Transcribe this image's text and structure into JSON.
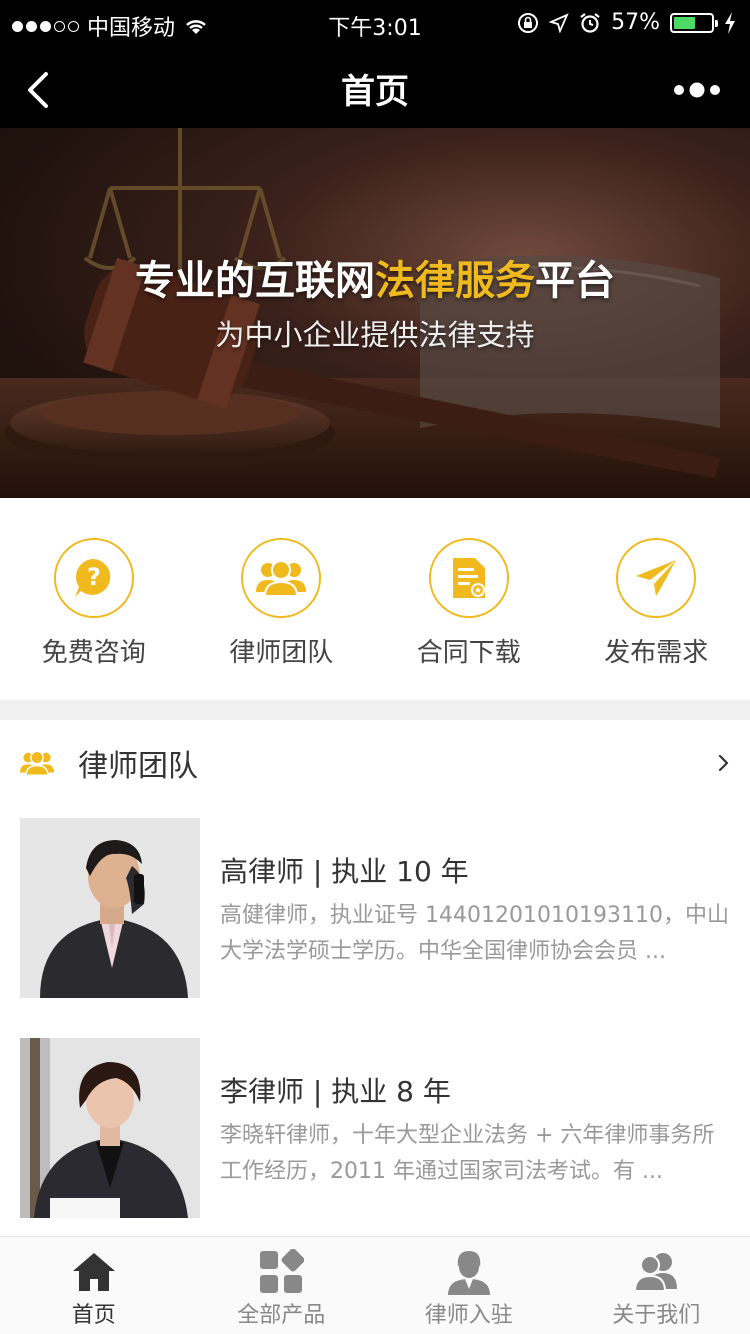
{
  "status_bar": {
    "carrier": "中国移动",
    "time": "下午3:01",
    "battery": "57%",
    "battery_level": 0.57,
    "icons": [
      "signal-dots-icon",
      "wifi-icon",
      "rotation-lock-icon",
      "location-icon",
      "alarm-icon",
      "battery-icon",
      "charging-icon"
    ]
  },
  "nav": {
    "title": "首页",
    "back_icon": "chevron-left-icon",
    "more_icon": "more-dots-icon"
  },
  "banner": {
    "headline_pre": "专业的互联网",
    "headline_highlight": "法律服务",
    "headline_post": "平台",
    "subtitle": "为中小企业提供法律支持",
    "highlight_color": "#f0b91e"
  },
  "entries": [
    {
      "label": "免费咨询",
      "icon": "question-bubble-icon"
    },
    {
      "label": "律师团队",
      "icon": "team-icon"
    },
    {
      "label": "合同下载",
      "icon": "contract-document-icon"
    },
    {
      "label": "发布需求",
      "icon": "paper-plane-icon"
    }
  ],
  "section": {
    "title": "律师团队",
    "icon": "team-icon",
    "more_icon": "chevron-right-icon"
  },
  "lawyers": [
    {
      "title": "高律师 | 执业 10 年",
      "desc": "高健律师，执业证号 14401201010193110，中山大学法学硕士学历。中华全国律师协会会员 ..."
    },
    {
      "title": "李律师 | 执业 8 年",
      "desc": "李晓轩律师，十年大型企业法务 + 六年律师事务所工作经历，2011 年通过国家司法考试。有 ..."
    }
  ],
  "tabs": [
    {
      "label": "首页",
      "icon": "home-icon",
      "active": true
    },
    {
      "label": "全部产品",
      "icon": "grid-icon",
      "active": false
    },
    {
      "label": "律师入驻",
      "icon": "lawyer-icon",
      "active": false
    },
    {
      "label": "关于我们",
      "icon": "people-icon",
      "active": false
    }
  ],
  "colors": {
    "accent": "#f0b91e",
    "nav_bg": "#000000",
    "text_muted": "#999999"
  }
}
